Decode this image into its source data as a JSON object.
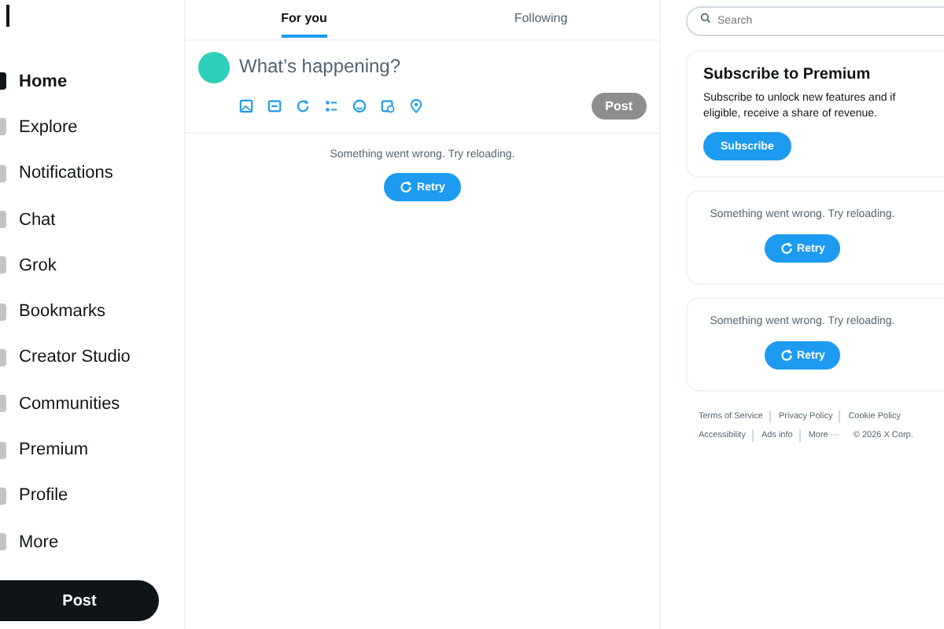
{
  "sidebar": {
    "items": [
      {
        "label": "Home",
        "selected": true
      },
      {
        "label": "Explore",
        "selected": false
      },
      {
        "label": "Notifications",
        "selected": false
      },
      {
        "label": "Chat",
        "selected": false
      },
      {
        "label": "Grok",
        "selected": false
      },
      {
        "label": "Bookmarks",
        "selected": false
      },
      {
        "label": "Creator Studio",
        "selected": false
      },
      {
        "label": "Communities",
        "selected": false
      },
      {
        "label": "Premium",
        "selected": false
      },
      {
        "label": "Profile",
        "selected": false
      },
      {
        "label": "More",
        "selected": false
      }
    ],
    "post_button": "Post"
  },
  "tabs": [
    {
      "label": "For you",
      "selected": true
    },
    {
      "label": "Following",
      "selected": false
    }
  ],
  "composer": {
    "placeholder": "What’s happening?",
    "post_button": "Post"
  },
  "feed_error": {
    "message": "Something went wrong. Try reloading.",
    "button": "Retry"
  },
  "search": {
    "placeholder": "Search"
  },
  "premium": {
    "title": "Subscribe to Premium",
    "text": "Subscribe to unlock new features and if eligible, receive a share of revenue.",
    "button": "Subscribe"
  },
  "error_cards": [
    {
      "message": "Something went wrong. Try reloading.",
      "button": "Retry"
    },
    {
      "message": "Something went wrong. Try reloading.",
      "button": "Retry"
    }
  ],
  "footer": {
    "links": [
      "Terms of Service",
      "Privacy Policy",
      "Cookie Policy",
      "Accessibility",
      "Ads info",
      "More ···"
    ],
    "copyright": "© 2026 X Corp."
  }
}
